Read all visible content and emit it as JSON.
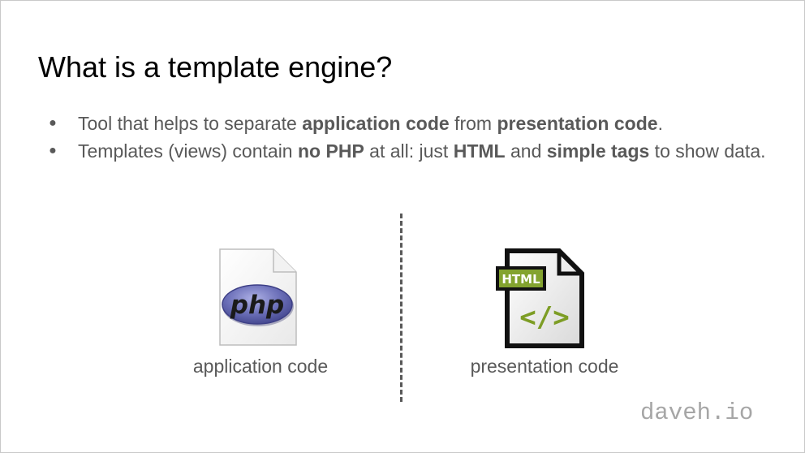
{
  "slide": {
    "title": "What is a template engine?",
    "bullets": [
      {
        "parts": [
          {
            "text": "Tool that helps to separate ",
            "bold": false
          },
          {
            "text": "application code",
            "bold": true
          },
          {
            "text": " from ",
            "bold": false
          },
          {
            "text": "presentation code",
            "bold": true
          },
          {
            "text": ".",
            "bold": false
          }
        ]
      },
      {
        "parts": [
          {
            "text": "Templates (views) contain ",
            "bold": false
          },
          {
            "text": "no PHP",
            "bold": true
          },
          {
            "text": " at all: just ",
            "bold": false
          },
          {
            "text": "HTML",
            "bold": true
          },
          {
            "text": " and ",
            "bold": false
          },
          {
            "text": "simple tags",
            "bold": true
          },
          {
            "text": " to show data.",
            "bold": false
          }
        ]
      }
    ],
    "bullet_marker": "●",
    "left_icon": {
      "name": "php-file-icon",
      "label": "php",
      "caption": "application code"
    },
    "right_icon": {
      "name": "html-file-icon",
      "badge": "HTML",
      "symbol": "</>",
      "caption": "presentation code"
    },
    "watermark": "daveh.io"
  },
  "colors": {
    "title": "#000000",
    "body_text": "#595959",
    "divider": "#595959",
    "watermark": "#a6a6a6",
    "php_oval": "#6b6fb8",
    "html_badge": "#83a32f",
    "html_symbol": "#7d9d25"
  }
}
